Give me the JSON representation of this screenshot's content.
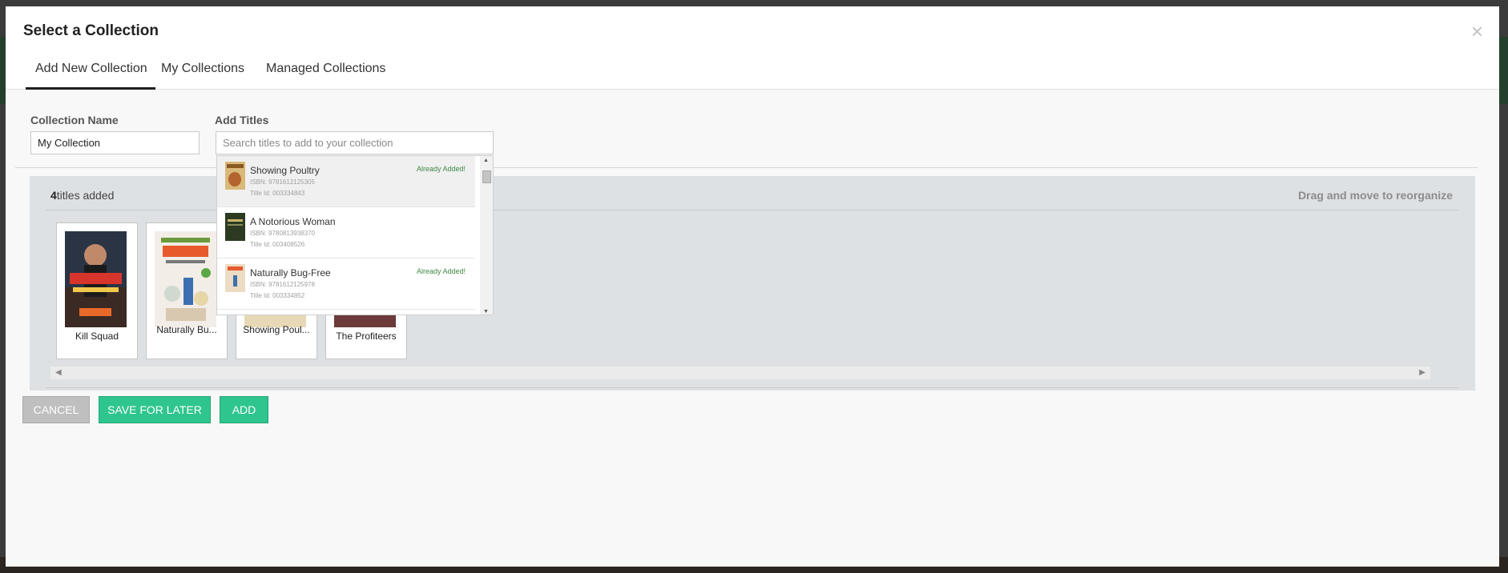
{
  "modal": {
    "title": "Select a Collection",
    "close_glyph": "×"
  },
  "tabs": [
    {
      "label": "Add New Collection",
      "active": true
    },
    {
      "label": "My Collections",
      "active": false
    },
    {
      "label": "Managed Collections",
      "active": false
    }
  ],
  "form": {
    "collection_name_label": "Collection Name",
    "collection_name_value": "My Collection",
    "add_titles_label": "Add Titles",
    "add_titles_placeholder": "Search titles to add to your collection"
  },
  "collection": {
    "count": "4",
    "count_suffix": "titles added",
    "drag_hint": "Drag and move to reorganize",
    "titles": [
      {
        "title": "Kill Squad",
        "cover_color": "#2a3445",
        "accent": "#d7352b"
      },
      {
        "title": "Naturally Bu...",
        "cover_color": "#f2ede6",
        "accent": "#e65a2c"
      },
      {
        "title": "Showing Poul...",
        "cover_color": "#e7d9b6",
        "accent": "#8a5a22"
      },
      {
        "title": "The Profiteers",
        "cover_color": "#6c3a3a",
        "accent": "#c9a04a"
      }
    ]
  },
  "search_results": [
    {
      "title": "Showing Poultry",
      "isbn": "ISBN: 9781612125305",
      "title_id": "Title Id: 003334843",
      "status": "Already Added!",
      "thumb_color": "#d8b97a"
    },
    {
      "title": "A Notorious Woman",
      "isbn": "ISBN: 9780813938370",
      "title_id": "Title Id: 003408526",
      "status": "",
      "thumb_color": "#2c3a22"
    },
    {
      "title": "Naturally Bug-Free",
      "isbn": "ISBN: 9781612125978",
      "title_id": "Title Id: 003334852",
      "status": "Already Added!",
      "thumb_color": "#ecdcc4"
    }
  ],
  "buttons": {
    "cancel": "CANCEL",
    "save_for_later": "SAVE FOR LATER",
    "add": "ADD"
  },
  "colors": {
    "primary_green": "#2fc58e",
    "cancel_gray": "#bfbfbf",
    "already_added": "#3f8a44"
  }
}
